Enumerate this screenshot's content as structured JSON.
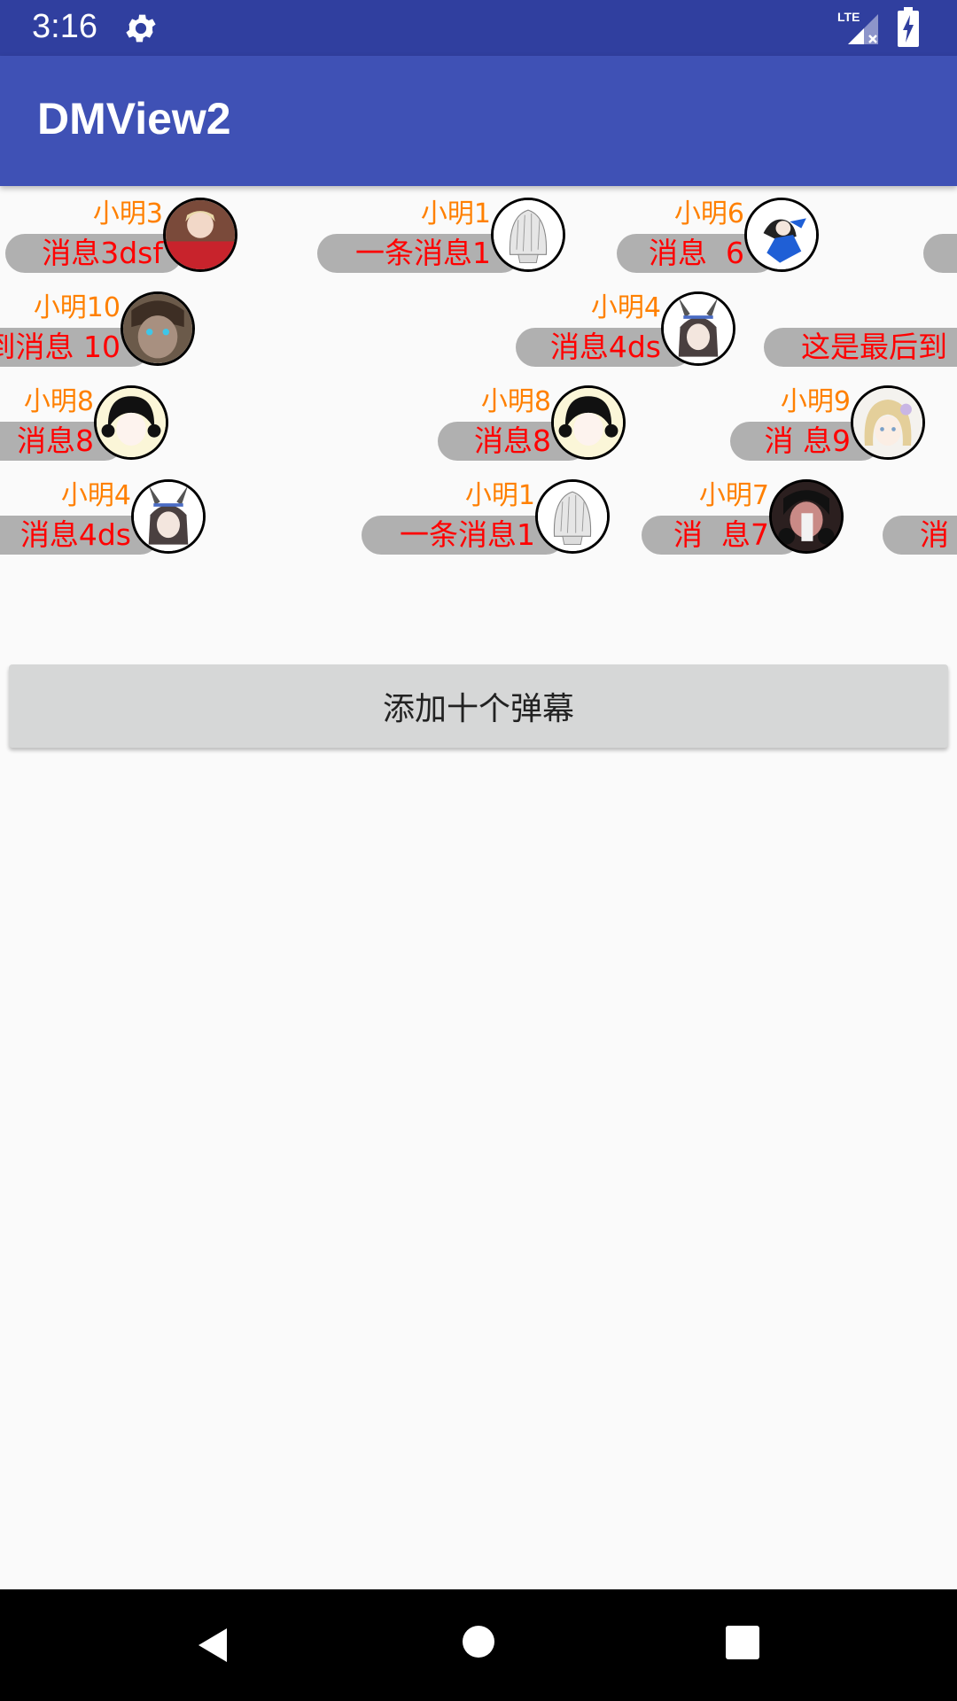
{
  "status_bar": {
    "time": "3:16",
    "network": "LTE",
    "icons": [
      "gear-icon",
      "lte-signal-icon",
      "battery-charging-icon"
    ]
  },
  "app_bar": {
    "title": "DMView2"
  },
  "danmaku": {
    "rows": [
      [
        {
          "name": "小明3",
          "message": "消息3dsf",
          "avatar": "avatar-red-dress"
        },
        {
          "name": "小明1",
          "message": "一条消息1",
          "avatar": "avatar-sketch"
        },
        {
          "name": "小明6",
          "message": "消息  6",
          "avatar": "avatar-blue-outfit"
        },
        {
          "name": "",
          "message": "",
          "avatar": ""
        }
      ],
      [
        {
          "name": "小明10",
          "message": "到消息 10",
          "avatar": "avatar-blue-eyes"
        },
        {
          "name": "小明4",
          "message": "消息4ds",
          "avatar": "avatar-horned"
        },
        {
          "name": "",
          "message": "这是最后到",
          "avatar": ""
        }
      ],
      [
        {
          "name": "小明8",
          "message": "消息8",
          "avatar": "avatar-dark-hair"
        },
        {
          "name": "小明8",
          "message": "消息8",
          "avatar": "avatar-dark-hair"
        },
        {
          "name": "小明9",
          "message": "消 息9",
          "avatar": "avatar-blonde"
        }
      ],
      [
        {
          "name": "小明4",
          "message": "消息4ds",
          "avatar": "avatar-horned"
        },
        {
          "name": "小明1",
          "message": "一条消息1",
          "avatar": "avatar-sketch"
        },
        {
          "name": "小明7",
          "message": "消  息7",
          "avatar": "avatar-dark-portrait"
        },
        {
          "name": "",
          "message": "消",
          "avatar": ""
        }
      ]
    ]
  },
  "add_button": {
    "label": "添加十个弹幕"
  },
  "nav_bar": {
    "icons": [
      "back-icon",
      "home-icon",
      "recents-icon"
    ]
  },
  "colors": {
    "status_bar": "#303f9f",
    "app_bar": "#3f51b5",
    "name": "#ff8000",
    "message": "#ff0000",
    "pill": "#b0b0b0"
  }
}
